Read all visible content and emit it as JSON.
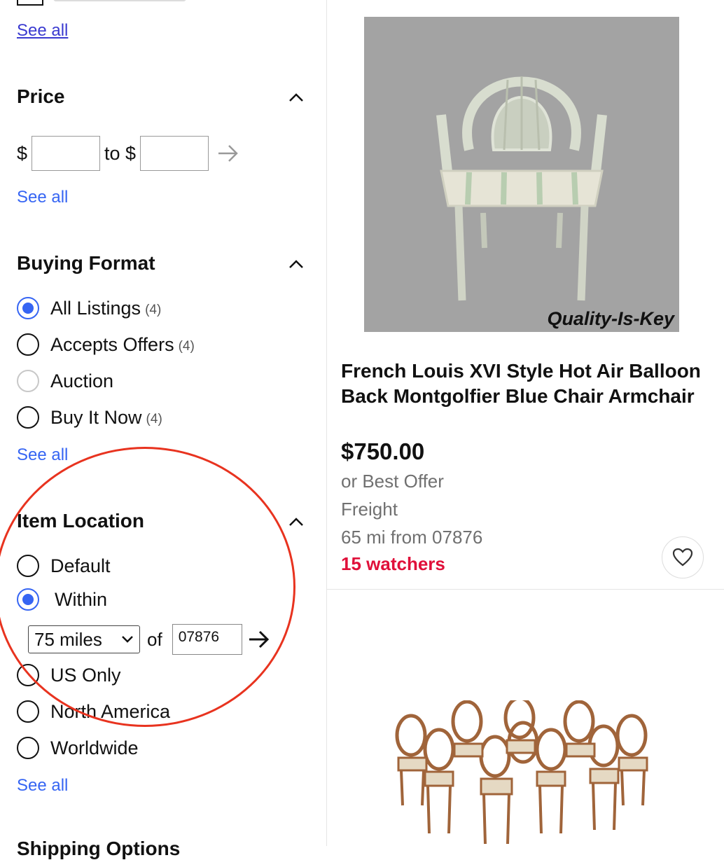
{
  "sidebar": {
    "top_see_all": "See all",
    "price": {
      "header": "Price",
      "currency_symbol": "$",
      "to_label": "to $",
      "min_value": "",
      "max_value": "",
      "see_all": "See all"
    },
    "buying_format": {
      "header": "Buying Format",
      "options": [
        {
          "label": "All Listings",
          "count": "(4)",
          "state": "checked"
        },
        {
          "label": "Accepts Offers",
          "count": "(4)",
          "state": "unchecked"
        },
        {
          "label": "Auction",
          "count": "",
          "state": "disabled"
        },
        {
          "label": "Buy It Now",
          "count": "(4)",
          "state": "unchecked"
        }
      ],
      "see_all": "See all"
    },
    "item_location": {
      "header": "Item Location",
      "options": [
        {
          "label": "Default",
          "state": "unchecked"
        },
        {
          "label": "Within",
          "state": "checked"
        },
        {
          "label": "US Only",
          "state": "unchecked"
        },
        {
          "label": "North America",
          "state": "unchecked"
        },
        {
          "label": "Worldwide",
          "state": "unchecked"
        }
      ],
      "distance_selected": "75 miles",
      "of_label": "of",
      "zip_value": "07876",
      "see_all": "See all"
    },
    "next_section_partial": "Shipping Options"
  },
  "product": {
    "image_watermark": "Quality-Is-Key",
    "title": "French Louis XVI Style Hot Air Balloon Back Montgolfier Blue Chair Armchair",
    "price": "$750.00",
    "best_offer": "or Best Offer",
    "shipping": "Freight",
    "distance": "65 mi from 07876",
    "watchers": "15 watchers"
  },
  "colors": {
    "accent": "#3665f3",
    "watchers": "#e0103a",
    "annotation": "#e8331f"
  },
  "icons": [
    "chevron-up-icon",
    "arrow-right-icon",
    "chevron-down-icon",
    "heart-icon"
  ]
}
